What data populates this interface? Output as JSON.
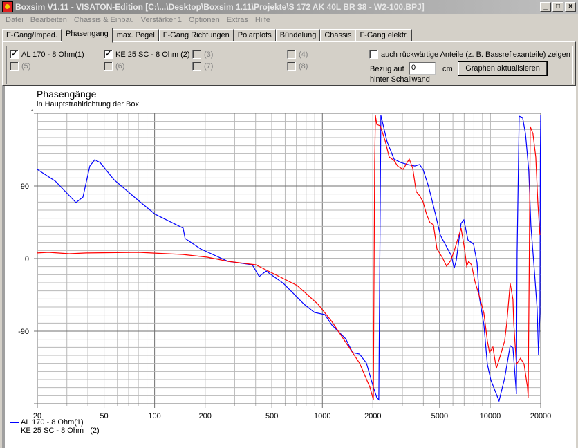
{
  "window": {
    "title": "Boxsim V1.11 - VISATON-Edition [C:\\...\\Desktop\\Boxsim 1.11\\Projekte\\S 172 AK 40L BR 38 - W2-100.BPJ]",
    "controls": [
      "_",
      "□",
      "×"
    ]
  },
  "menu": [
    "Datei",
    "Bearbeiten",
    "Chassis & Einbau",
    "Verstärker 1",
    "Optionen",
    "Extras",
    "Hilfe"
  ],
  "tabs": [
    "F-Gang/Imped.",
    "Phasengang",
    "max. Pegel",
    "F-Gang Richtungen",
    "Polarplots",
    "Bündelung",
    "Chassis",
    "F-Gang elektr."
  ],
  "active_tab": "Phasengang",
  "drivers": [
    {
      "label": "AL 170 - 8 Ohm(1)",
      "checked": true,
      "enabled": true
    },
    {
      "label": "KE 25 SC - 8 Ohm   (2)",
      "checked": true,
      "enabled": true
    },
    {
      "label": "(3)",
      "checked": false,
      "enabled": false
    },
    {
      "label": "(4)",
      "checked": false,
      "enabled": false
    },
    {
      "label": "(5)",
      "checked": false,
      "enabled": false
    },
    {
      "label": "(6)",
      "checked": false,
      "enabled": false
    },
    {
      "label": "(7)",
      "checked": false,
      "enabled": false
    },
    {
      "label": "(8)",
      "checked": false,
      "enabled": false
    }
  ],
  "options": {
    "rear_label": "auch rückwärtige Anteile (z. B. Bassreflexanteile) zeigen",
    "rear_checked": false,
    "ref_label": "Bezug auf",
    "ref_value": "0",
    "ref_unit": "cm",
    "ref_sub": "hinter Schallwand",
    "update_button": "Graphen aktualisieren"
  },
  "chart_data": {
    "type": "line",
    "title": "Phasengänge",
    "subtitle": "in Hauptstrahlrichtung der Box",
    "ylabel": "°",
    "x_scale": "log",
    "xlim": [
      20,
      20000
    ],
    "ylim": [
      -180,
      180
    ],
    "x_ticks": [
      20,
      50,
      100,
      200,
      500,
      1000,
      2000,
      5000,
      10000,
      20000
    ],
    "y_ticks": [
      90,
      0,
      -90
    ],
    "grid": true,
    "legend": "bottom-left",
    "series": [
      {
        "name": "AL 170 - 8 Ohm(1)",
        "color": "#0000ff",
        "points": [
          [
            20,
            110.6
          ],
          [
            25.6,
            96
          ],
          [
            34,
            69.4
          ],
          [
            37.4,
            76.3
          ],
          [
            41.1,
            114.8
          ],
          [
            44,
            122.6
          ],
          [
            47.4,
            119
          ],
          [
            57.3,
            97.7
          ],
          [
            80,
            72
          ],
          [
            101,
            54.8
          ],
          [
            148,
            37.7
          ],
          [
            152,
            24.9
          ],
          [
            188,
            12
          ],
          [
            274,
            -3.4
          ],
          [
            382,
            -7.7
          ],
          [
            420,
            -22.3
          ],
          [
            462,
            -15.4
          ],
          [
            586,
            -30.8
          ],
          [
            778,
            -56.6
          ],
          [
            897,
            -66.8
          ],
          [
            1035,
            -69.4
          ],
          [
            1138,
            -82.3
          ],
          [
            1377,
            -99.4
          ],
          [
            1514,
            -116.6
          ],
          [
            1664,
            -118.3
          ],
          [
            1829,
            -129.4
          ],
          [
            2012,
            -159.4
          ],
          [
            2110,
            -172.3
          ],
          [
            2170,
            -174.9
          ],
          [
            2200,
            0
          ],
          [
            2232,
            177.4
          ],
          [
            2432,
            144.8
          ],
          [
            2673,
            123.4
          ],
          [
            2940,
            119
          ],
          [
            3230,
            116.6
          ],
          [
            3556,
            114.8
          ],
          [
            3797,
            116.6
          ],
          [
            3982,
            110.6
          ],
          [
            4298,
            89.1
          ],
          [
            4722,
            54.8
          ],
          [
            5049,
            29.1
          ],
          [
            5876,
            3.4
          ],
          [
            6104,
            -12
          ],
          [
            6280,
            -2.6
          ],
          [
            6713,
            43.7
          ],
          [
            6970,
            48
          ],
          [
            7380,
            23.1
          ],
          [
            7963,
            18
          ],
          [
            8352,
            -5.1
          ],
          [
            8590,
            -45.4
          ],
          [
            9180,
            -82.3
          ],
          [
            9622,
            -131.1
          ],
          [
            10100,
            -150.8
          ],
          [
            11300,
            -176.5
          ],
          [
            12200,
            -148.3
          ],
          [
            13160,
            -108
          ],
          [
            13670,
            -110.6
          ],
          [
            14060,
            -144.8
          ],
          [
            14330,
            -168
          ],
          [
            14470,
            6
          ],
          [
            14890,
            176.5
          ],
          [
            15600,
            174.8
          ],
          [
            16230,
            155.1
          ],
          [
            16990,
            108.8
          ],
          [
            17500,
            40.3
          ],
          [
            18360,
            -16.3
          ],
          [
            19060,
            -62.6
          ],
          [
            19420,
            -119.1
          ],
          [
            19800,
            -67.7
          ],
          [
            19900,
            126
          ],
          [
            20000,
            177.4
          ]
        ]
      },
      {
        "name": "KE 25 SC - 8 Ohm   (2)",
        "color": "#ff0000",
        "points": [
          [
            20,
            6.9
          ],
          [
            23.3,
            7.7
          ],
          [
            31,
            6
          ],
          [
            39.2,
            6.9
          ],
          [
            80,
            7.7
          ],
          [
            148,
            5.1
          ],
          [
            206,
            1.7
          ],
          [
            274,
            -3.4
          ],
          [
            401,
            -7.7
          ],
          [
            533,
            -20.6
          ],
          [
            708,
            -33.4
          ],
          [
            942,
            -56.6
          ],
          [
            1138,
            -78
          ],
          [
            1377,
            -103.7
          ],
          [
            1664,
            -129.4
          ],
          [
            1919,
            -159.4
          ],
          [
            2012,
            -174.9
          ],
          [
            2020,
            -116.6
          ],
          [
            2050,
            117.4
          ],
          [
            2070,
            177.4
          ],
          [
            2110,
            166.3
          ],
          [
            2212,
            164.5
          ],
          [
            2362,
            146.5
          ],
          [
            2500,
            126
          ],
          [
            2673,
            121.7
          ],
          [
            2805,
            114.8
          ],
          [
            3027,
            110.6
          ],
          [
            3295,
            123.4
          ],
          [
            3455,
            112.3
          ],
          [
            3625,
            83.1
          ],
          [
            3797,
            78
          ],
          [
            3982,
            70.3
          ],
          [
            4180,
            54.8
          ],
          [
            4380,
            44.6
          ],
          [
            4590,
            42
          ],
          [
            4817,
            12
          ],
          [
            5198,
            0.9
          ],
          [
            5499,
            -9.4
          ],
          [
            5822,
            -2.6
          ],
          [
            6104,
            9.4
          ],
          [
            6713,
            37.7
          ],
          [
            7034,
            12
          ],
          [
            7244,
            -9.4
          ],
          [
            7450,
            -3.4
          ],
          [
            7745,
            -7.7
          ],
          [
            8115,
            -28.3
          ],
          [
            8590,
            -45.4
          ],
          [
            9180,
            -67.7
          ],
          [
            9622,
            -102
          ],
          [
            9910,
            -116.6
          ],
          [
            10380,
            -109.7
          ],
          [
            10890,
            -136.3
          ],
          [
            11640,
            -116.6
          ],
          [
            12200,
            -102
          ],
          [
            12560,
            -79.7
          ],
          [
            13160,
            -30.9
          ],
          [
            13670,
            -50.6
          ],
          [
            13810,
            -79.7
          ],
          [
            14330,
            -131.1
          ],
          [
            15180,
            -123.4
          ],
          [
            15920,
            -131.1
          ],
          [
            16680,
            -159.4
          ],
          [
            16840,
            -172.3
          ],
          [
            17100,
            -5.1
          ],
          [
            17330,
            163.7
          ],
          [
            17990,
            155.1
          ],
          [
            18700,
            126
          ],
          [
            19240,
            69.4
          ],
          [
            19800,
            29.1
          ]
        ]
      }
    ]
  }
}
